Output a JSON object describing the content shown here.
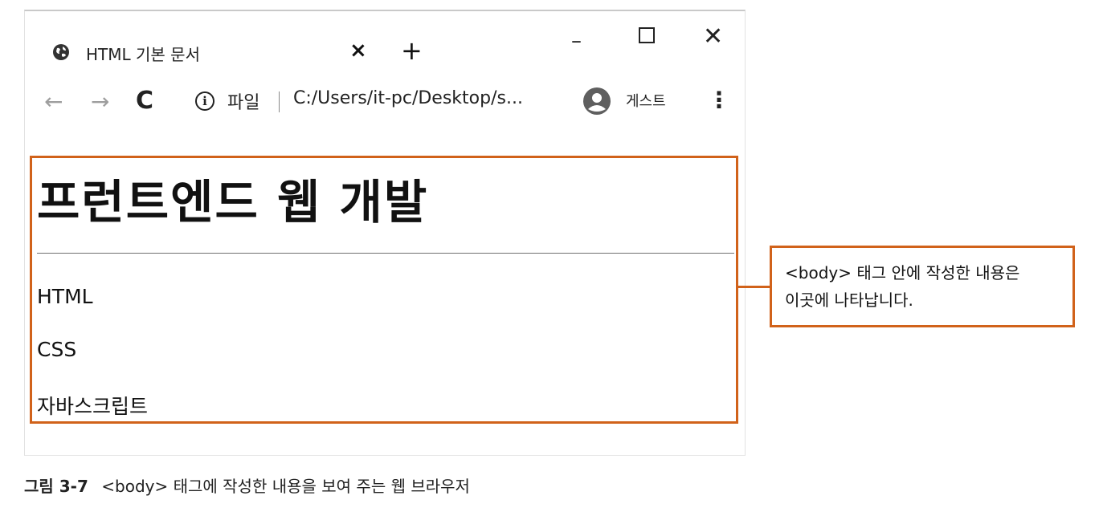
{
  "browser": {
    "tab": {
      "title": "HTML 기본 문서",
      "close_glyph": "×",
      "new_tab_glyph": "+"
    },
    "window_controls": {
      "minimize": "–",
      "close": "✕"
    },
    "toolbar": {
      "back": "←",
      "forward": "→",
      "reload": "C",
      "info": "i",
      "scheme_label": "파일",
      "url": "C:/Users/it-pc/Desktop/s...",
      "profile_label": "게스트",
      "menu": "⋮"
    }
  },
  "page": {
    "heading": "프런트엔드 웹 개발",
    "items": [
      "HTML",
      "CSS",
      "자바스크립트"
    ]
  },
  "callout": {
    "lines": [
      "<body> 태그 안에 작성한 내용은",
      "이곳에 나타납니다."
    ]
  },
  "caption": {
    "number": "그림 3-7",
    "text": "<body> 태그에 작성한 내용을 보여 주는 웹 브라우저"
  },
  "colors": {
    "highlight": "#d1621a"
  },
  "icons": {
    "tab": "globe-icon",
    "info": "info-icon",
    "profile": "avatar-icon",
    "menu": "more-vertical-icon"
  }
}
